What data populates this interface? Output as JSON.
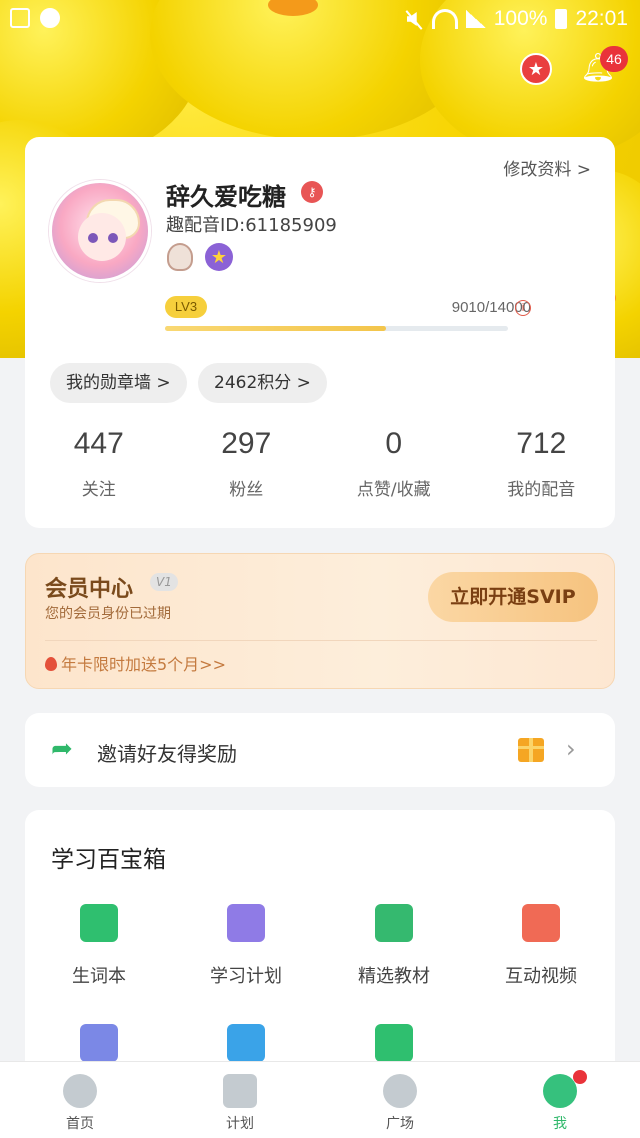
{
  "status_bar": {
    "battery": "100%",
    "time": "22:01"
  },
  "header": {
    "notification_count": "46"
  },
  "profile": {
    "edit_label": "修改资料 >",
    "username": "辞久爱吃糖",
    "user_id": "趣配音ID:61185909",
    "level": "LV3",
    "xp_text": "9010/14000",
    "xp_progress": 0.6436,
    "medal_wall_label": "我的勋章墙 >",
    "points_label": "2462积分 >",
    "stats": [
      {
        "value": "447",
        "label": "关注"
      },
      {
        "value": "297",
        "label": "粉丝"
      },
      {
        "value": "0",
        "label": "点赞/收藏"
      },
      {
        "value": "712",
        "label": "我的配音"
      }
    ]
  },
  "vip": {
    "title": "会员中心",
    "tag": "V1",
    "subtitle": "您的会员身份已过期",
    "button_label": "立即开通SVIP",
    "promo": "年卡限时加送5个月>>"
  },
  "invite": {
    "label": "邀请好友得奖励"
  },
  "toolbox": {
    "title": "学习百宝箱",
    "items": [
      {
        "label": "生词本",
        "icon": "notebook-icon",
        "color": "#2fbf6f"
      },
      {
        "label": "学习计划",
        "icon": "calendar-icon",
        "color": "#8f7be6"
      },
      {
        "label": "精选教材",
        "icon": "textbook-icon",
        "color": "#35b96f"
      },
      {
        "label": "互动视频",
        "icon": "tv-icon",
        "color": "#f06a55"
      },
      {
        "label": "",
        "icon": "quiz-icon",
        "color": "#7b88e6"
      },
      {
        "label": "",
        "icon": "chart-icon",
        "color": "#3aa3e8"
      },
      {
        "label": "",
        "icon": "list-icon",
        "color": "#2fbf6f"
      }
    ]
  },
  "bottom_nav": [
    {
      "label": "首页",
      "icon": "play-icon"
    },
    {
      "label": "计划",
      "icon": "book-icon"
    },
    {
      "label": "广场",
      "icon": "chat-icon"
    },
    {
      "label": "我",
      "icon": "me-icon"
    }
  ],
  "colors": {
    "accent": "#2fb86a",
    "badge": "#e9333a",
    "vip_text": "#7a4a1c"
  }
}
